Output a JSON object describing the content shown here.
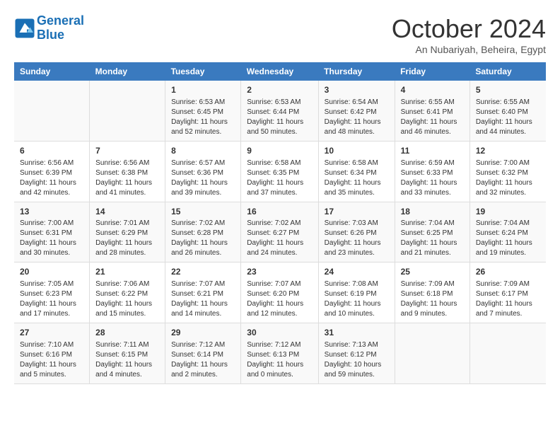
{
  "logo": {
    "line1": "General",
    "line2": "Blue"
  },
  "title": "October 2024",
  "subtitle": "An Nubariyah, Beheira, Egypt",
  "headers": [
    "Sunday",
    "Monday",
    "Tuesday",
    "Wednesday",
    "Thursday",
    "Friday",
    "Saturday"
  ],
  "weeks": [
    [
      {
        "day": "",
        "info": ""
      },
      {
        "day": "",
        "info": ""
      },
      {
        "day": "1",
        "info": "Sunrise: 6:53 AM\nSunset: 6:45 PM\nDaylight: 11 hours and 52 minutes."
      },
      {
        "day": "2",
        "info": "Sunrise: 6:53 AM\nSunset: 6:44 PM\nDaylight: 11 hours and 50 minutes."
      },
      {
        "day": "3",
        "info": "Sunrise: 6:54 AM\nSunset: 6:42 PM\nDaylight: 11 hours and 48 minutes."
      },
      {
        "day": "4",
        "info": "Sunrise: 6:55 AM\nSunset: 6:41 PM\nDaylight: 11 hours and 46 minutes."
      },
      {
        "day": "5",
        "info": "Sunrise: 6:55 AM\nSunset: 6:40 PM\nDaylight: 11 hours and 44 minutes."
      }
    ],
    [
      {
        "day": "6",
        "info": "Sunrise: 6:56 AM\nSunset: 6:39 PM\nDaylight: 11 hours and 42 minutes."
      },
      {
        "day": "7",
        "info": "Sunrise: 6:56 AM\nSunset: 6:38 PM\nDaylight: 11 hours and 41 minutes."
      },
      {
        "day": "8",
        "info": "Sunrise: 6:57 AM\nSunset: 6:36 PM\nDaylight: 11 hours and 39 minutes."
      },
      {
        "day": "9",
        "info": "Sunrise: 6:58 AM\nSunset: 6:35 PM\nDaylight: 11 hours and 37 minutes."
      },
      {
        "day": "10",
        "info": "Sunrise: 6:58 AM\nSunset: 6:34 PM\nDaylight: 11 hours and 35 minutes."
      },
      {
        "day": "11",
        "info": "Sunrise: 6:59 AM\nSunset: 6:33 PM\nDaylight: 11 hours and 33 minutes."
      },
      {
        "day": "12",
        "info": "Sunrise: 7:00 AM\nSunset: 6:32 PM\nDaylight: 11 hours and 32 minutes."
      }
    ],
    [
      {
        "day": "13",
        "info": "Sunrise: 7:00 AM\nSunset: 6:31 PM\nDaylight: 11 hours and 30 minutes."
      },
      {
        "day": "14",
        "info": "Sunrise: 7:01 AM\nSunset: 6:29 PM\nDaylight: 11 hours and 28 minutes."
      },
      {
        "day": "15",
        "info": "Sunrise: 7:02 AM\nSunset: 6:28 PM\nDaylight: 11 hours and 26 minutes."
      },
      {
        "day": "16",
        "info": "Sunrise: 7:02 AM\nSunset: 6:27 PM\nDaylight: 11 hours and 24 minutes."
      },
      {
        "day": "17",
        "info": "Sunrise: 7:03 AM\nSunset: 6:26 PM\nDaylight: 11 hours and 23 minutes."
      },
      {
        "day": "18",
        "info": "Sunrise: 7:04 AM\nSunset: 6:25 PM\nDaylight: 11 hours and 21 minutes."
      },
      {
        "day": "19",
        "info": "Sunrise: 7:04 AM\nSunset: 6:24 PM\nDaylight: 11 hours and 19 minutes."
      }
    ],
    [
      {
        "day": "20",
        "info": "Sunrise: 7:05 AM\nSunset: 6:23 PM\nDaylight: 11 hours and 17 minutes."
      },
      {
        "day": "21",
        "info": "Sunrise: 7:06 AM\nSunset: 6:22 PM\nDaylight: 11 hours and 15 minutes."
      },
      {
        "day": "22",
        "info": "Sunrise: 7:07 AM\nSunset: 6:21 PM\nDaylight: 11 hours and 14 minutes."
      },
      {
        "day": "23",
        "info": "Sunrise: 7:07 AM\nSunset: 6:20 PM\nDaylight: 11 hours and 12 minutes."
      },
      {
        "day": "24",
        "info": "Sunrise: 7:08 AM\nSunset: 6:19 PM\nDaylight: 11 hours and 10 minutes."
      },
      {
        "day": "25",
        "info": "Sunrise: 7:09 AM\nSunset: 6:18 PM\nDaylight: 11 hours and 9 minutes."
      },
      {
        "day": "26",
        "info": "Sunrise: 7:09 AM\nSunset: 6:17 PM\nDaylight: 11 hours and 7 minutes."
      }
    ],
    [
      {
        "day": "27",
        "info": "Sunrise: 7:10 AM\nSunset: 6:16 PM\nDaylight: 11 hours and 5 minutes."
      },
      {
        "day": "28",
        "info": "Sunrise: 7:11 AM\nSunset: 6:15 PM\nDaylight: 11 hours and 4 minutes."
      },
      {
        "day": "29",
        "info": "Sunrise: 7:12 AM\nSunset: 6:14 PM\nDaylight: 11 hours and 2 minutes."
      },
      {
        "day": "30",
        "info": "Sunrise: 7:12 AM\nSunset: 6:13 PM\nDaylight: 11 hours and 0 minutes."
      },
      {
        "day": "31",
        "info": "Sunrise: 7:13 AM\nSunset: 6:12 PM\nDaylight: 10 hours and 59 minutes."
      },
      {
        "day": "",
        "info": ""
      },
      {
        "day": "",
        "info": ""
      }
    ]
  ]
}
